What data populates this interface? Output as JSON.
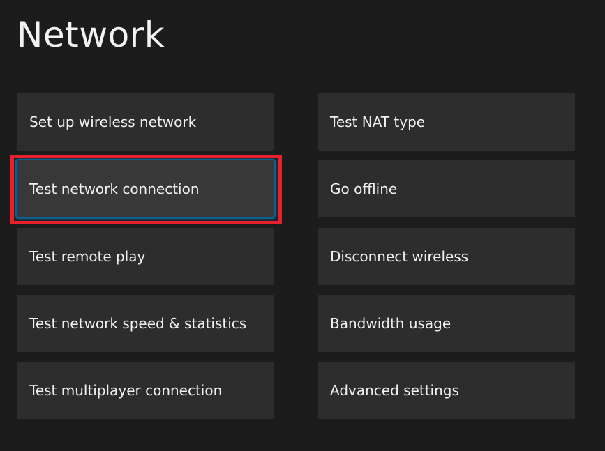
{
  "page": {
    "title": "Network"
  },
  "colors": {
    "background": "#1c1c1c",
    "tile": "#2d2d2d",
    "tile_focused": "#383838",
    "focus_glow": "#1070b0",
    "highlight_border": "#e8202b"
  },
  "left_column": {
    "items": [
      {
        "label": "Set up wireless network"
      },
      {
        "label": "Test network connection",
        "focused": true
      },
      {
        "label": "Test remote play"
      },
      {
        "label": "Test network speed & statistics"
      },
      {
        "label": "Test multiplayer connection"
      }
    ]
  },
  "right_column": {
    "items": [
      {
        "label": "Test NAT type"
      },
      {
        "label": "Go offline"
      },
      {
        "label": "Disconnect wireless"
      },
      {
        "label": "Bandwidth usage"
      },
      {
        "label": "Advanced settings"
      }
    ]
  }
}
